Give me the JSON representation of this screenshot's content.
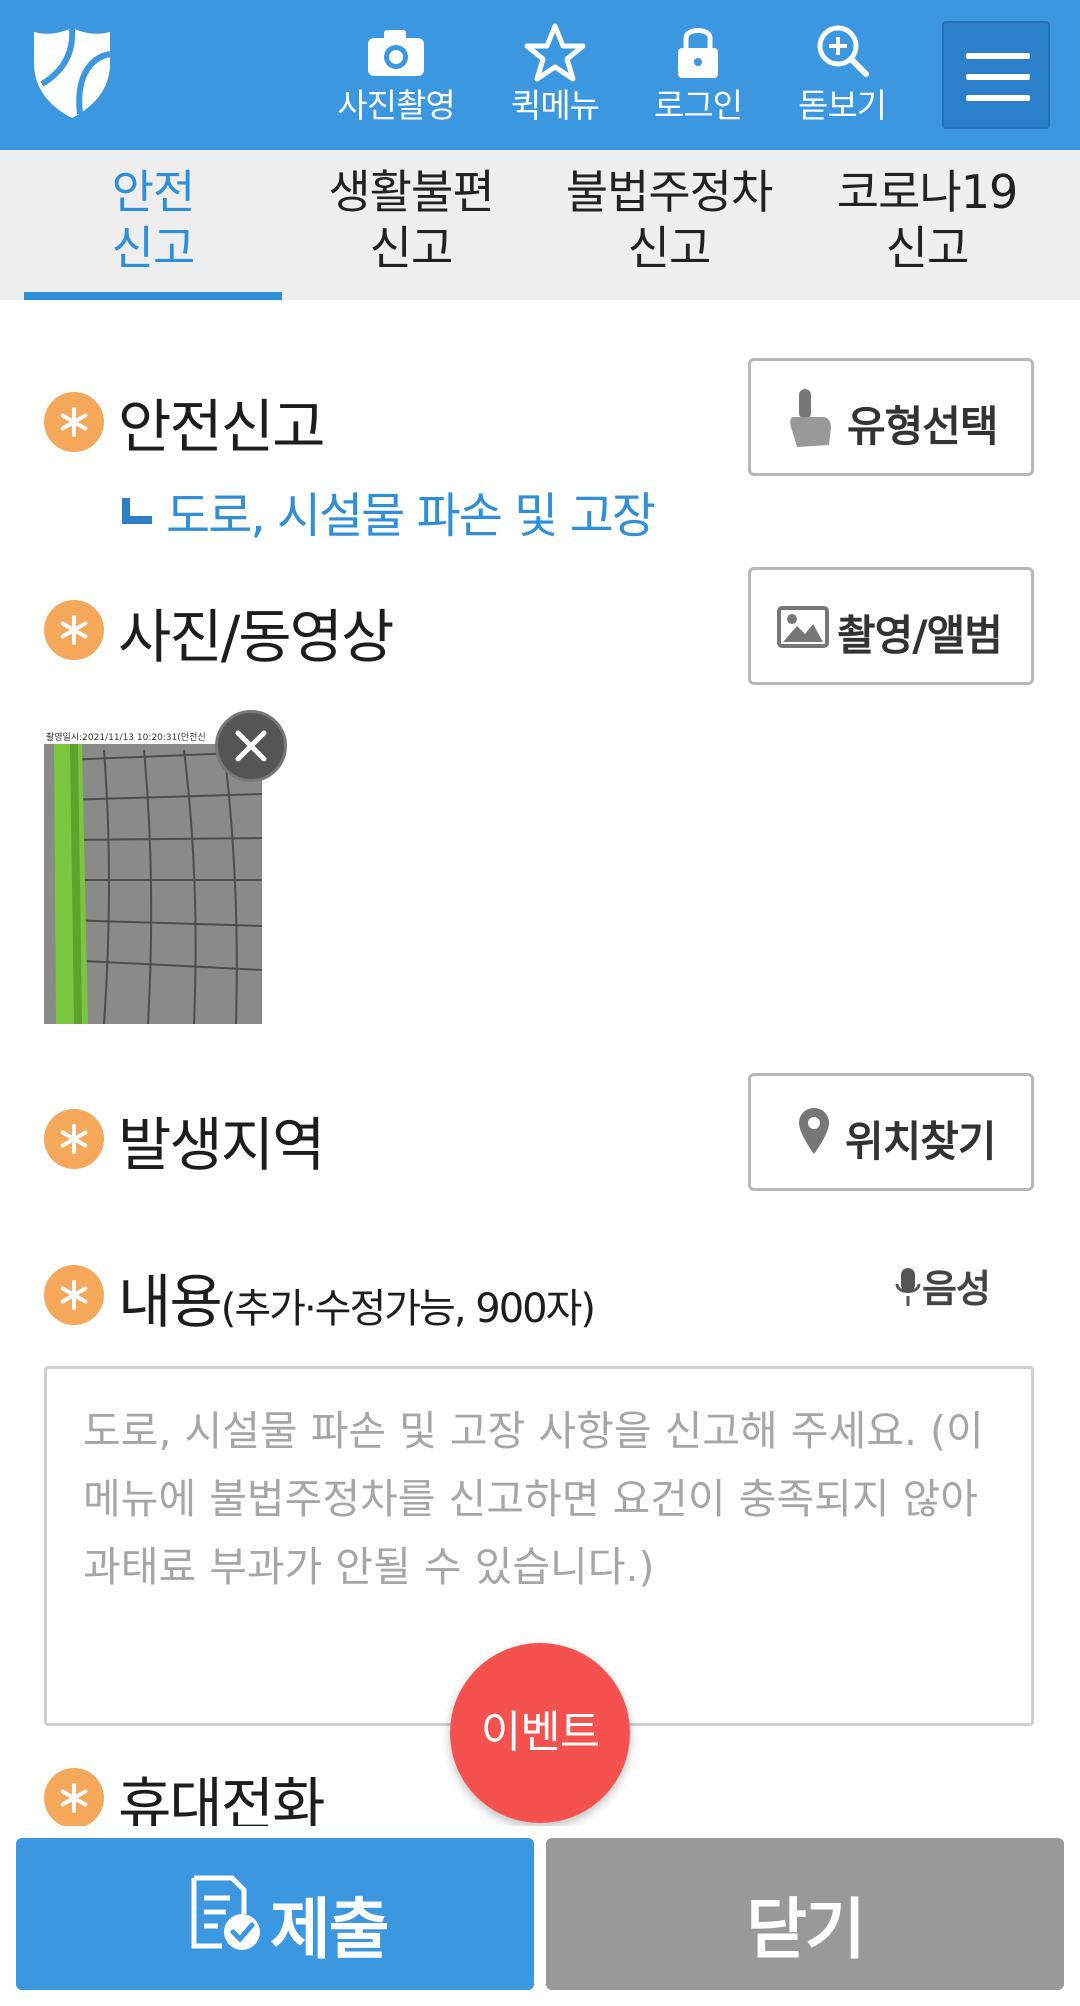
{
  "header": {
    "logo": "shield-logo",
    "buttons": [
      {
        "label": "사진촬영",
        "icon": "camera-icon"
      },
      {
        "label": "퀵메뉴",
        "icon": "star-icon"
      },
      {
        "label": "로그인",
        "icon": "lock-icon"
      },
      {
        "label": "돋보기",
        "icon": "magnifier-plus-icon"
      }
    ],
    "menu_icon": "hamburger-icon"
  },
  "tabs": [
    {
      "line1": "안전",
      "line2": "신고",
      "active": true
    },
    {
      "line1": "생활불편",
      "line2": "신고",
      "active": false
    },
    {
      "line1": "불법주정차",
      "line2": "신고",
      "active": false
    },
    {
      "line1": "코로나19",
      "line2": "신고",
      "active": false
    }
  ],
  "form": {
    "type": {
      "title": "안전신고",
      "button": "유형선택",
      "selected_category": "도로, 시설물 파손 및 고장"
    },
    "media": {
      "title": "사진/동영상",
      "button": "촬영/앨범",
      "photo_caption": "촬영일시:2021/11/13 10:20:31(안전신"
    },
    "location": {
      "title": "발생지역",
      "button": "위치찾기"
    },
    "content": {
      "title": "내용",
      "subtitle": "(추가·수정가능, 900자)",
      "voice_label": "음성",
      "placeholder": "도로, 시설물 파손 및 고장 사항을 신고해 주세요. (이 메뉴에 불법주정차를 신고하면 요건이 충족되지 않아 과태료 부과가 안될 수 있습니다.)"
    },
    "phone": {
      "title": "휴대전화"
    }
  },
  "event_button": "이벤트",
  "footer": {
    "submit": "제출",
    "close": "닫기"
  },
  "colors": {
    "primary": "#3a97e0",
    "accent_orange": "#f5a75a",
    "event_red": "#f5524f",
    "close_gray": "#999999"
  }
}
